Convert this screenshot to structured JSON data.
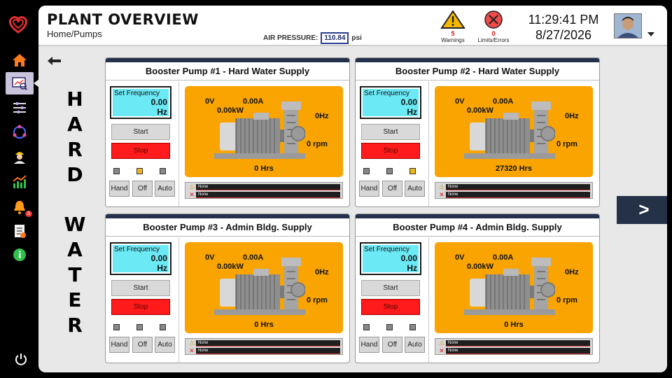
{
  "header": {
    "title": "PLANT OVERVIEW",
    "breadcrumb": "Home/Pumps",
    "air_pressure_label": "AIR PRESSURE:",
    "air_pressure_value": "110.84",
    "air_pressure_unit": "psi",
    "warnings_count": "5",
    "warnings_label": "Warnings",
    "errors_count": "0",
    "errors_label": "Limits/Errors",
    "time": "11:29:41 PM",
    "date": "8/27/2026"
  },
  "sidebar": {
    "alerts_badge": "5"
  },
  "section_label": {
    "word1": [
      "H",
      "A",
      "R",
      "D"
    ],
    "word2": [
      "W",
      "A",
      "T",
      "E",
      "R"
    ]
  },
  "next_label": ">",
  "pumps": [
    {
      "title": "Booster Pump #1 - Hard Water Supply",
      "freq_label": "Set Frequency",
      "freq_value": "0.00",
      "freq_unit": "Hz",
      "start": "Start",
      "stop": "Stop",
      "modes": [
        "Hand",
        "Off",
        "Auto"
      ],
      "leds": [
        false,
        true,
        false
      ],
      "voltage": "0V",
      "current": "0.00A",
      "power": "0.00kW",
      "hz": "0Hz",
      "rpm": "0 rpm",
      "hours": "0 Hrs",
      "alarm1": "None",
      "alarm2": "None"
    },
    {
      "title": "Booster Pump #2 - Hard Water Supply",
      "freq_label": "Set Frequency",
      "freq_value": "0.00",
      "freq_unit": "Hz",
      "start": "Start",
      "stop": "Stop",
      "modes": [
        "Hand",
        "Off",
        "Auto"
      ],
      "leds": [
        false,
        false,
        true
      ],
      "voltage": "0V",
      "current": "0.00A",
      "power": "0.00kW",
      "hz": "0Hz",
      "rpm": "0 rpm",
      "hours": "27320 Hrs",
      "alarm1": "None",
      "alarm2": "None"
    },
    {
      "title": "Booster Pump #3 - Admin Bldg. Supply",
      "freq_label": "Set Frequency",
      "freq_value": "0.00",
      "freq_unit": "Hz",
      "start": "Start",
      "stop": "Stop",
      "modes": [
        "Hand",
        "Off",
        "Auto"
      ],
      "leds": [
        false,
        false,
        false
      ],
      "voltage": "0V",
      "current": "0.00A",
      "power": "0.00kW",
      "hz": "0Hz",
      "rpm": "0 rpm",
      "hours": "0 Hrs",
      "alarm1": "None",
      "alarm2": "None"
    },
    {
      "title": "Booster Pump #4 - Admin Bldg. Supply",
      "freq_label": "Set Frequency",
      "freq_value": "0.00",
      "freq_unit": "Hz",
      "start": "Start",
      "stop": "Stop",
      "modes": [
        "Hand",
        "Off",
        "Auto"
      ],
      "leds": [
        false,
        false,
        false
      ],
      "voltage": "0V",
      "current": "0.00A",
      "power": "0.00kW",
      "hz": "0Hz",
      "rpm": "0 rpm",
      "hours": "0 Hrs",
      "alarm1": "None",
      "alarm2": "None"
    }
  ],
  "colors": {
    "panel_orange": "#f9a400",
    "freq_cyan": "#6be9f5",
    "stop_red": "#ff1b1b",
    "led_on": "#f0b41c",
    "navy": "#24314d"
  }
}
